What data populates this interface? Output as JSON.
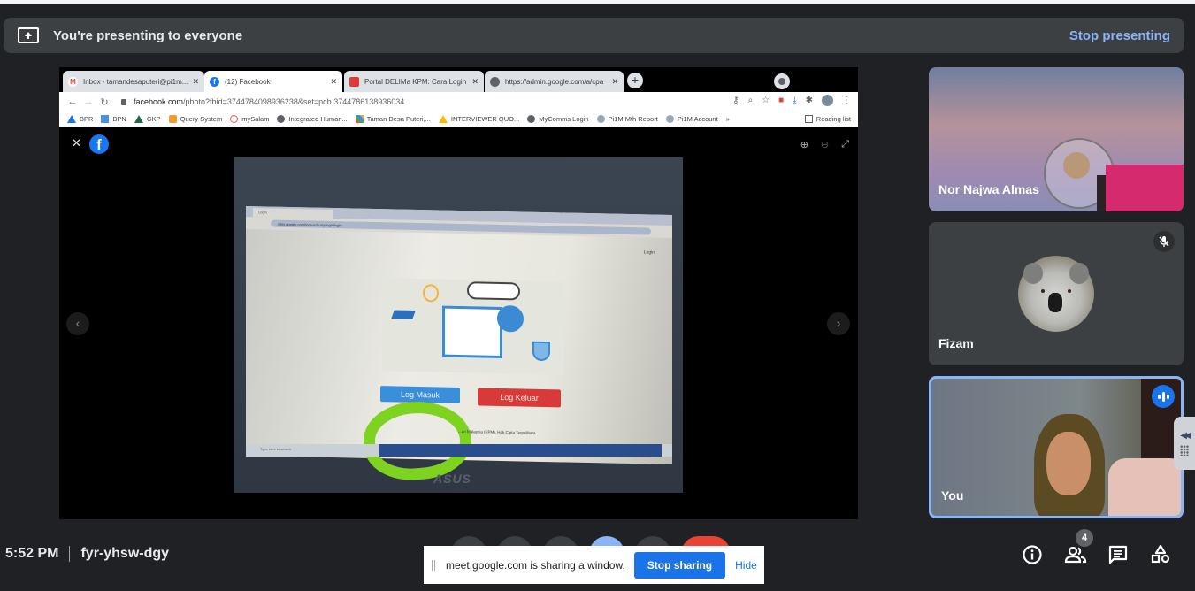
{
  "banner": {
    "message": "You're presenting to everyone",
    "stop_label": "Stop presenting"
  },
  "shared_window": {
    "tabs": [
      {
        "title": "Inbox - tamandesaputeri@pi1m...",
        "icon": "gmail-icon",
        "active": false
      },
      {
        "title": "(12) Facebook",
        "icon": "facebook-icon",
        "active": true
      },
      {
        "title": "Portal DELIMa KPM: Cara Login (",
        "icon": "portal-icon",
        "active": false
      },
      {
        "title": "https://admin.google.com/a/cpa",
        "icon": "globe-icon",
        "active": false
      }
    ],
    "url_host": "facebook.com",
    "url_path": "/photo?fbid=3744784098936238&set=pcb.3744786138936034",
    "bookmarks": [
      {
        "label": "BPR",
        "icon": "drive-icon"
      },
      {
        "label": "BPN",
        "icon": "doc-icon"
      },
      {
        "label": "GKP",
        "icon": "drive-icon"
      },
      {
        "label": "Query System",
        "icon": "app-icon"
      },
      {
        "label": "mySalam",
        "icon": "heart-icon"
      },
      {
        "label": "Integrated Human...",
        "icon": "globe-icon"
      },
      {
        "label": "Taman Desa Puteri,...",
        "icon": "joomla-icon"
      },
      {
        "label": "INTERVIEWER QUO...",
        "icon": "drive-icon"
      },
      {
        "label": "MyComms Login",
        "icon": "globe-icon"
      },
      {
        "label": "Pi1M Mth Report",
        "icon": "site-icon"
      },
      {
        "label": "Pi1M Account",
        "icon": "site-icon"
      }
    ],
    "bookmarks_more": "»",
    "reading_list": "Reading list",
    "photo": {
      "tab_title": "Login",
      "address": "sites.google.com/moe-edu.my/login/login",
      "header_link": "Login",
      "button_login": "Log Masuk",
      "button_logout": "Log Keluar",
      "footer": "...an Malaysia (KPM). Hak Cipta Terpelihara",
      "taskbar_search": "Type here to search",
      "brand": "ASUS"
    }
  },
  "participants": [
    {
      "name": "Nor Najwa Almas",
      "muted": false,
      "speaking": false
    },
    {
      "name": "Fizam",
      "muted": true,
      "speaking": false
    },
    {
      "name": "You",
      "muted": false,
      "speaking": true
    }
  ],
  "footer": {
    "time": "5:52 PM",
    "meeting_code": "fyr-yhsw-dgy",
    "participant_count": "4"
  },
  "share_notice": {
    "message": "meet.google.com is sharing a window.",
    "stop_label": "Stop sharing",
    "hide_label": "Hide"
  },
  "colors": {
    "accent": "#8ab4f8",
    "primary_button": "#1a73e8",
    "end_call": "#ea4335",
    "background": "#202124",
    "surface": "#3c4043"
  }
}
